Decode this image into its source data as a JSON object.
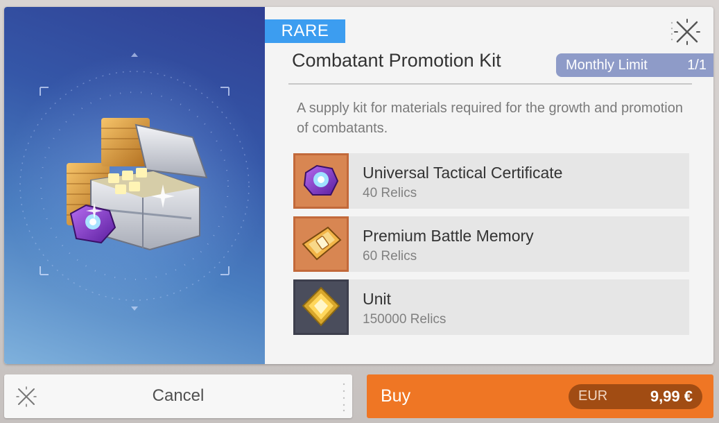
{
  "item": {
    "rarity": "RARE",
    "name": "Combatant Promotion Kit",
    "description": "A supply kit for materials required for the growth and promotion of combatants."
  },
  "limit": {
    "label": "Monthly Limit",
    "value": "1/1"
  },
  "contents": [
    {
      "name": "Universal Tactical Certificate",
      "quantity": "40 Relics",
      "icon": "certificate-icon"
    },
    {
      "name": "Premium Battle Memory",
      "quantity": "60 Relics",
      "icon": "battle-memory-icon"
    },
    {
      "name": "Unit",
      "quantity": "150000 Relics",
      "icon": "unit-currency-icon"
    }
  ],
  "actions": {
    "cancel_label": "Cancel",
    "buy_label": "Buy",
    "currency": "EUR",
    "price": "9,99 €"
  },
  "colors": {
    "rarity": "#3c9df0",
    "buy": "#ef7624",
    "limit": "#8e9bc8"
  }
}
